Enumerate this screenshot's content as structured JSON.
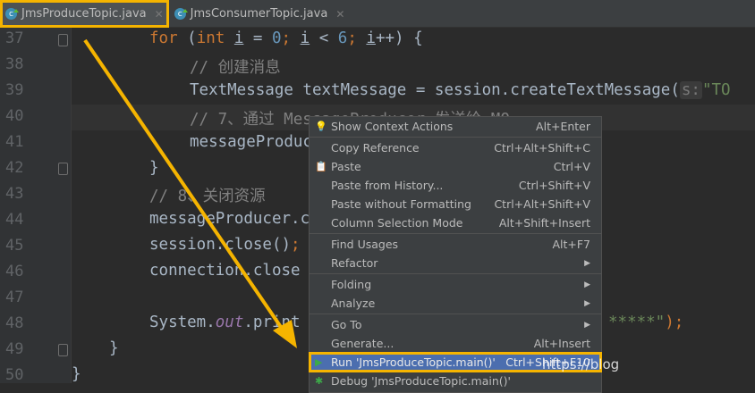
{
  "tabs": [
    {
      "label": "JmsProduceTopic.java",
      "active": true
    },
    {
      "label": "JmsConsumerTopic.java",
      "active": false
    }
  ],
  "line_numbers": [
    "37",
    "38",
    "39",
    "40",
    "41",
    "42",
    "43",
    "44",
    "45",
    "46",
    "47",
    "48",
    "49",
    "50"
  ],
  "code": {
    "l37": {
      "kw1": "for",
      "p1": " (",
      "kw2": "int",
      "p2": " ",
      "v1": "i",
      "p3": " = ",
      "n1": "0",
      "p4": "; ",
      "v2": "i",
      "p5": " < ",
      "n2": "6",
      "p6": "; ",
      "v3": "i",
      "p7": "++) {"
    },
    "l38": "// 创建消息",
    "l39": {
      "text": "TextMessage textMessage = session.createTextMessage(",
      "hint": "s:",
      "str": "\"TO"
    },
    "l40": "// 7、通过 MessageProducer 发送给 MQ",
    "l41": "messageProduc",
    "l42": "}",
    "l43": "// 8、关闭资源",
    "l44": "messageProducer.c",
    "l45a": "session.close()",
    "l45b": ";",
    "l46": "connection.close",
    "l48": {
      "a": "System.",
      "b": "out",
      "c": ".print",
      "tail": "*****\"",
      "end": ");"
    },
    "l49": "}",
    "l50": "}"
  },
  "menu": [
    {
      "label": "Show Context Actions",
      "shortcut": "Alt+Enter",
      "icon": "bulb"
    },
    {
      "label": "Copy Reference",
      "shortcut": "Ctrl+Alt+Shift+C"
    },
    {
      "label": "Paste",
      "shortcut": "Ctrl+V",
      "icon": "clipboard"
    },
    {
      "label": "Paste from History...",
      "shortcut": "Ctrl+Shift+V"
    },
    {
      "label": "Paste without Formatting",
      "shortcut": "Ctrl+Alt+Shift+V"
    },
    {
      "label": "Column Selection Mode",
      "shortcut": "Alt+Shift+Insert"
    },
    {
      "label": "Find Usages",
      "shortcut": "Alt+F7"
    },
    {
      "label": "Refactor",
      "shortcut": "▶"
    },
    {
      "label": "Folding",
      "shortcut": "▶"
    },
    {
      "label": "Analyze",
      "shortcut": "▶"
    },
    {
      "label": "Go To",
      "shortcut": "▶"
    },
    {
      "label": "Generate...",
      "shortcut": "Alt+Insert"
    },
    {
      "label": "Run 'JmsProduceTopic.main()'",
      "shortcut": "Ctrl+Shift+F10",
      "icon": "run"
    },
    {
      "label": "Debug 'JmsProduceTopic.main()'",
      "icon": "debug"
    }
  ],
  "watermark": "https://blog",
  "colors": {
    "highlight": "#f5b400",
    "selection": "#4b6eaf"
  }
}
